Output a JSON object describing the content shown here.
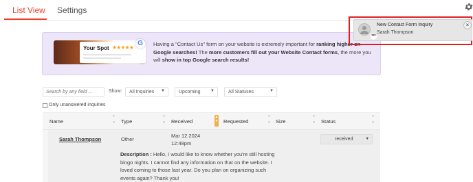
{
  "tabs": [
    {
      "label": "List View",
      "active": true
    },
    {
      "label": "Settings",
      "active": false
    }
  ],
  "icons": {
    "settings": "gear-icon",
    "google": "google-icon",
    "avatar": "user-icon",
    "close": "close-icon"
  },
  "banner": {
    "card_name": "Your Spot",
    "card_stars": "★★★★★",
    "google_letter": "G",
    "text_parts": [
      {
        "t": "Having a \"Contact Us\" form on your website is extremely important for ",
        "bold": false
      },
      {
        "t": "ranking higher on Google searches!",
        "bold": true
      },
      {
        "t": " The ",
        "bold": false
      },
      {
        "t": "more customers fill out your Website Contact forms",
        "bold": true
      },
      {
        "t": ", the more you will ",
        "bold": false
      },
      {
        "t": "show in top Google search results!",
        "bold": true
      }
    ]
  },
  "filters": {
    "search_placeholder": "Search by any field ...",
    "show_label": "Show:",
    "inquiries": "All Inquiries",
    "timeframe": "Upcoming",
    "statuses": "All Statuses",
    "only_unanswered": "Only unanswered inquiries"
  },
  "table": {
    "headers": {
      "name": "Name",
      "type": "Type",
      "received": "Received",
      "requested": "Requested",
      "size": "Size",
      "status": "Status"
    },
    "row": {
      "name": "Sarah Thompson",
      "type": "Other",
      "received_date": "Mar 12 2024",
      "received_time": "12:48pm",
      "status": "received",
      "description_label": "Description :",
      "description": " Hello, I would like to know whether you're still hosting bingo nights. I cannot find any information on that on the website. I loved coming to those last year. Do you plan on organizing such events again? Thank you!"
    }
  },
  "notification": {
    "title": "New Contact Form Inquiry",
    "subtitle": "Sarah Thompson",
    "close": "×",
    "more": "•••"
  },
  "colors": {
    "accent": "#e8452c",
    "highlight_frame": "#e21c24",
    "banner_bg": "#ece6f8",
    "sort_highlight": "#f0b04a"
  }
}
